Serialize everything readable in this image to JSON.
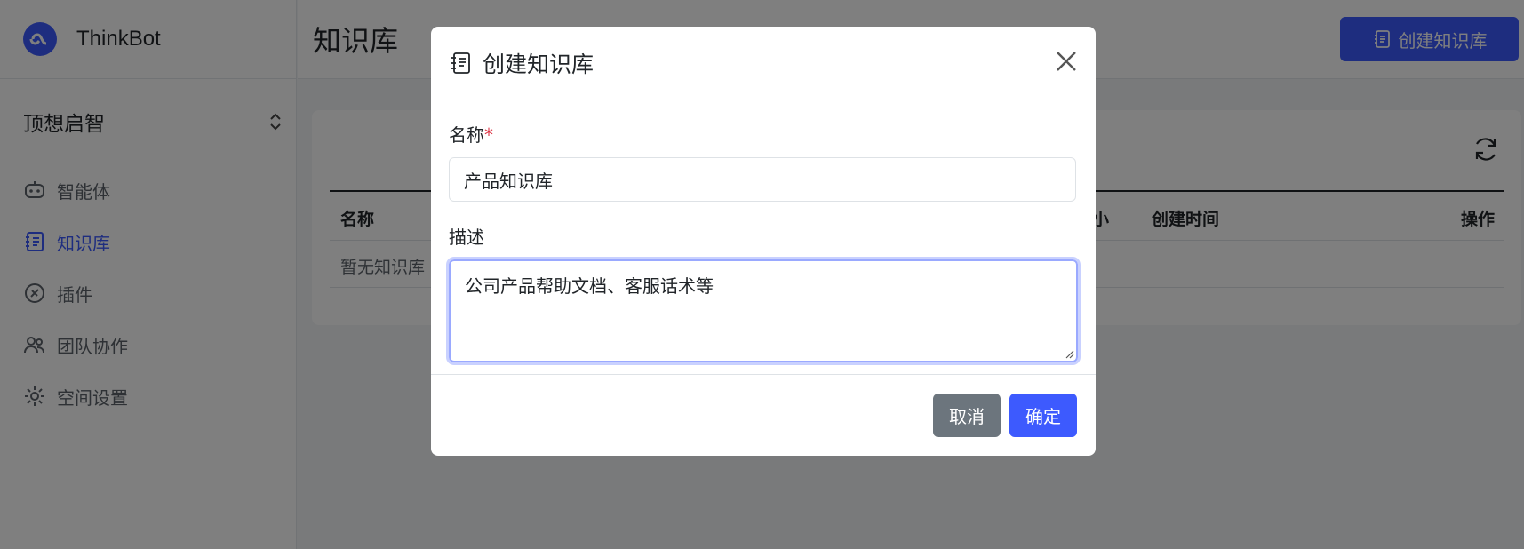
{
  "brand": {
    "name": "ThinkBot"
  },
  "sidebar": {
    "team": "顶想启智",
    "items": [
      {
        "label": "智能体"
      },
      {
        "label": "知识库"
      },
      {
        "label": "插件"
      },
      {
        "label": "团队协作"
      },
      {
        "label": "空间设置"
      }
    ]
  },
  "header": {
    "title": "知识库",
    "create_label": "创建知识库"
  },
  "table": {
    "columns": [
      "名称",
      "小",
      "创建时间",
      "操作"
    ],
    "empty": "暂无知识库"
  },
  "modal": {
    "title": "创建知识库",
    "name_label": "名称",
    "required_mark": "*",
    "name_value": "产品知识库",
    "desc_label": "描述",
    "desc_value": "公司产品帮助文档、客服话术等",
    "cancel_label": "取消",
    "ok_label": "确定"
  },
  "colors": {
    "accent": "#3d5afe",
    "overlay": "rgba(0,0,0,0.5)"
  }
}
